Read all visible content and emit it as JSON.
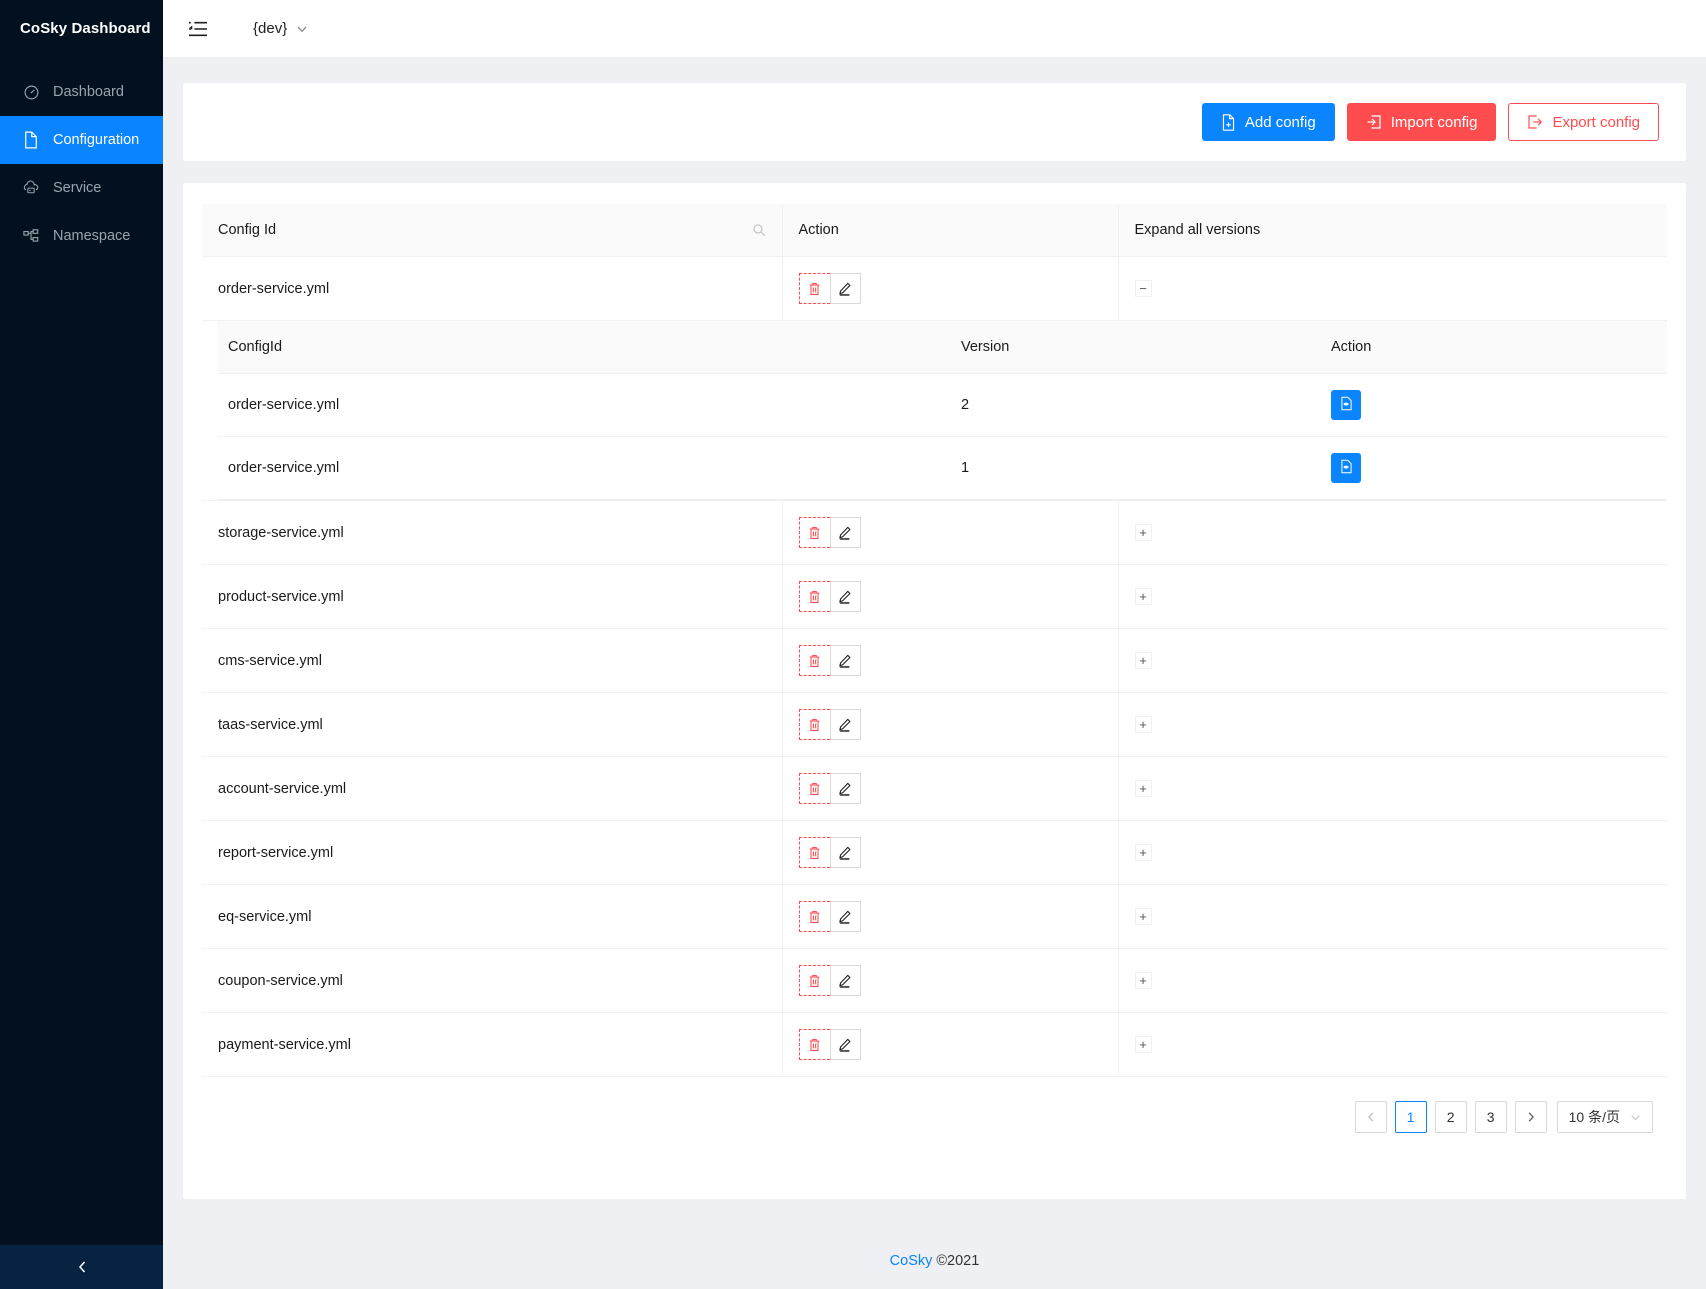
{
  "sidebar": {
    "brand": "CoSky Dashboard",
    "items": [
      {
        "label": "Dashboard",
        "icon": "dashboard-icon",
        "active": false
      },
      {
        "label": "Configuration",
        "icon": "file-icon",
        "active": true
      },
      {
        "label": "Service",
        "icon": "cloud-server-icon",
        "active": false
      },
      {
        "label": "Namespace",
        "icon": "apartment-icon",
        "active": false
      }
    ],
    "collapse_icon": "chevron-left-icon"
  },
  "topbar": {
    "fold_icon": "menu-fold-icon",
    "namespace": "{dev}",
    "namespace_caret": "chevron-down-icon"
  },
  "toolbar": {
    "add_label": "Add config",
    "add_icon": "file-add-icon",
    "import_label": "Import config",
    "import_icon": "import-icon",
    "export_label": "Export config",
    "export_icon": "export-icon",
    "primary_color": "#0a84ff",
    "danger_color": "#ff4d4f"
  },
  "table": {
    "headers": {
      "config_id": "Config Id",
      "action": "Action",
      "expand": "Expand all versions"
    },
    "search_icon": "search-icon",
    "delete_icon": "delete-icon",
    "edit_icon": "edit-icon",
    "rows": [
      {
        "config_id": "order-service.yml",
        "expanded": true,
        "expand_glyph": "−"
      },
      {
        "config_id": "storage-service.yml",
        "expanded": false,
        "expand_glyph": "+"
      },
      {
        "config_id": "product-service.yml",
        "expanded": false,
        "expand_glyph": "+"
      },
      {
        "config_id": "cms-service.yml",
        "expanded": false,
        "expand_glyph": "+"
      },
      {
        "config_id": "taas-service.yml",
        "expanded": false,
        "expand_glyph": "+"
      },
      {
        "config_id": "account-service.yml",
        "expanded": false,
        "expand_glyph": "+"
      },
      {
        "config_id": "report-service.yml",
        "expanded": false,
        "expand_glyph": "+"
      },
      {
        "config_id": "eq-service.yml",
        "expanded": false,
        "expand_glyph": "+"
      },
      {
        "config_id": "coupon-service.yml",
        "expanded": false,
        "expand_glyph": "+"
      },
      {
        "config_id": "payment-service.yml",
        "expanded": false,
        "expand_glyph": "+"
      }
    ],
    "nested": {
      "headers": {
        "config_id": "ConfigId",
        "version": "Version",
        "action": "Action"
      },
      "view_icon": "file-view-icon",
      "rows": [
        {
          "config_id": "order-service.yml",
          "version": "2"
        },
        {
          "config_id": "order-service.yml",
          "version": "1"
        }
      ]
    }
  },
  "pagination": {
    "prev": "‹",
    "next": "›",
    "pages": [
      "1",
      "2",
      "3"
    ],
    "current": "1",
    "page_size": "10 条/页",
    "size_caret": "chevron-down-icon"
  },
  "footer": {
    "link": "CoSky",
    "copyright": "©2021"
  }
}
